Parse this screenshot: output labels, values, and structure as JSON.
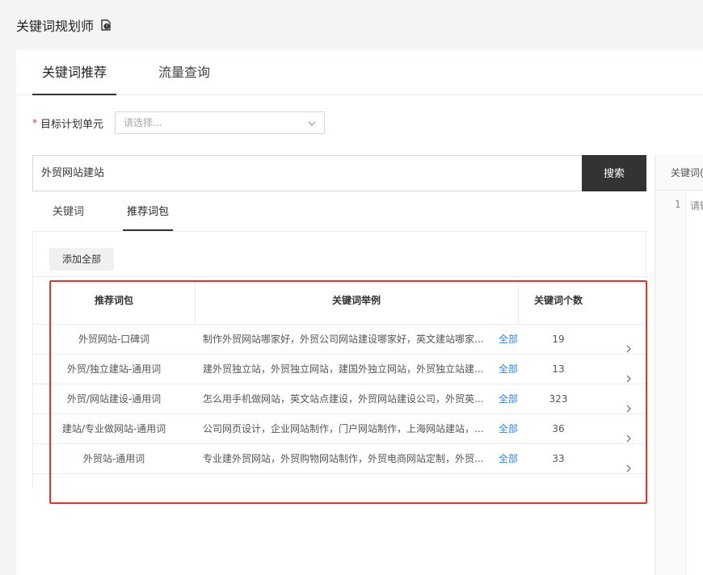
{
  "header": {
    "title": "关键词规划师",
    "help_icon": "help-doc-icon"
  },
  "main_tabs": [
    {
      "label": "关键词推荐",
      "active": true
    },
    {
      "label": "流量查询",
      "active": false
    }
  ],
  "target": {
    "required_mark": "*",
    "label": "目标计划单元",
    "placeholder": "请选择..."
  },
  "search": {
    "value": "外贸网站建站",
    "button_label": "搜索"
  },
  "sub_tabs": [
    {
      "label": "关键词",
      "active": false
    },
    {
      "label": "推荐词包",
      "active": true
    }
  ],
  "add_all_label": "添加全部",
  "table": {
    "headers": [
      "推荐词包",
      "关键词举例",
      "关键词个数"
    ],
    "rows": [
      {
        "package": "外贸网站-口碑词",
        "examples": "制作外贸网站哪家好，外贸公司网站建设哪家好，英文建站哪家...",
        "all_link": "全部",
        "count": "19"
      },
      {
        "package": "外贸/独立建站-通用词",
        "examples": "建外贸独立站，外贸独立网站，建国外独立网站，外贸独立站建...",
        "all_link": "全部",
        "count": "13"
      },
      {
        "package": "外贸/网站建设-通用词",
        "examples": "怎么用手机做网站，英文站点建设，外贸网站建设公司，外贸英...",
        "all_link": "全部",
        "count": "323"
      },
      {
        "package": "建站/专业做网站-通用词",
        "examples": "公司网页设计，企业网站制作，门户网站制作，上海网站建站，...",
        "all_link": "全部",
        "count": "36"
      },
      {
        "package": "外贸站-通用词",
        "examples": "专业建外贸网站，外贸购物网站制作，外贸电商网站定制，外贸...",
        "all_link": "全部",
        "count": "33"
      }
    ]
  },
  "side_panel": {
    "header": "关键词(",
    "line_number": "1",
    "placeholder": "请输"
  },
  "colors": {
    "accent": "#333333",
    "link": "#2b85e4",
    "highlight": "#e5332a",
    "required": "#e5332a"
  }
}
